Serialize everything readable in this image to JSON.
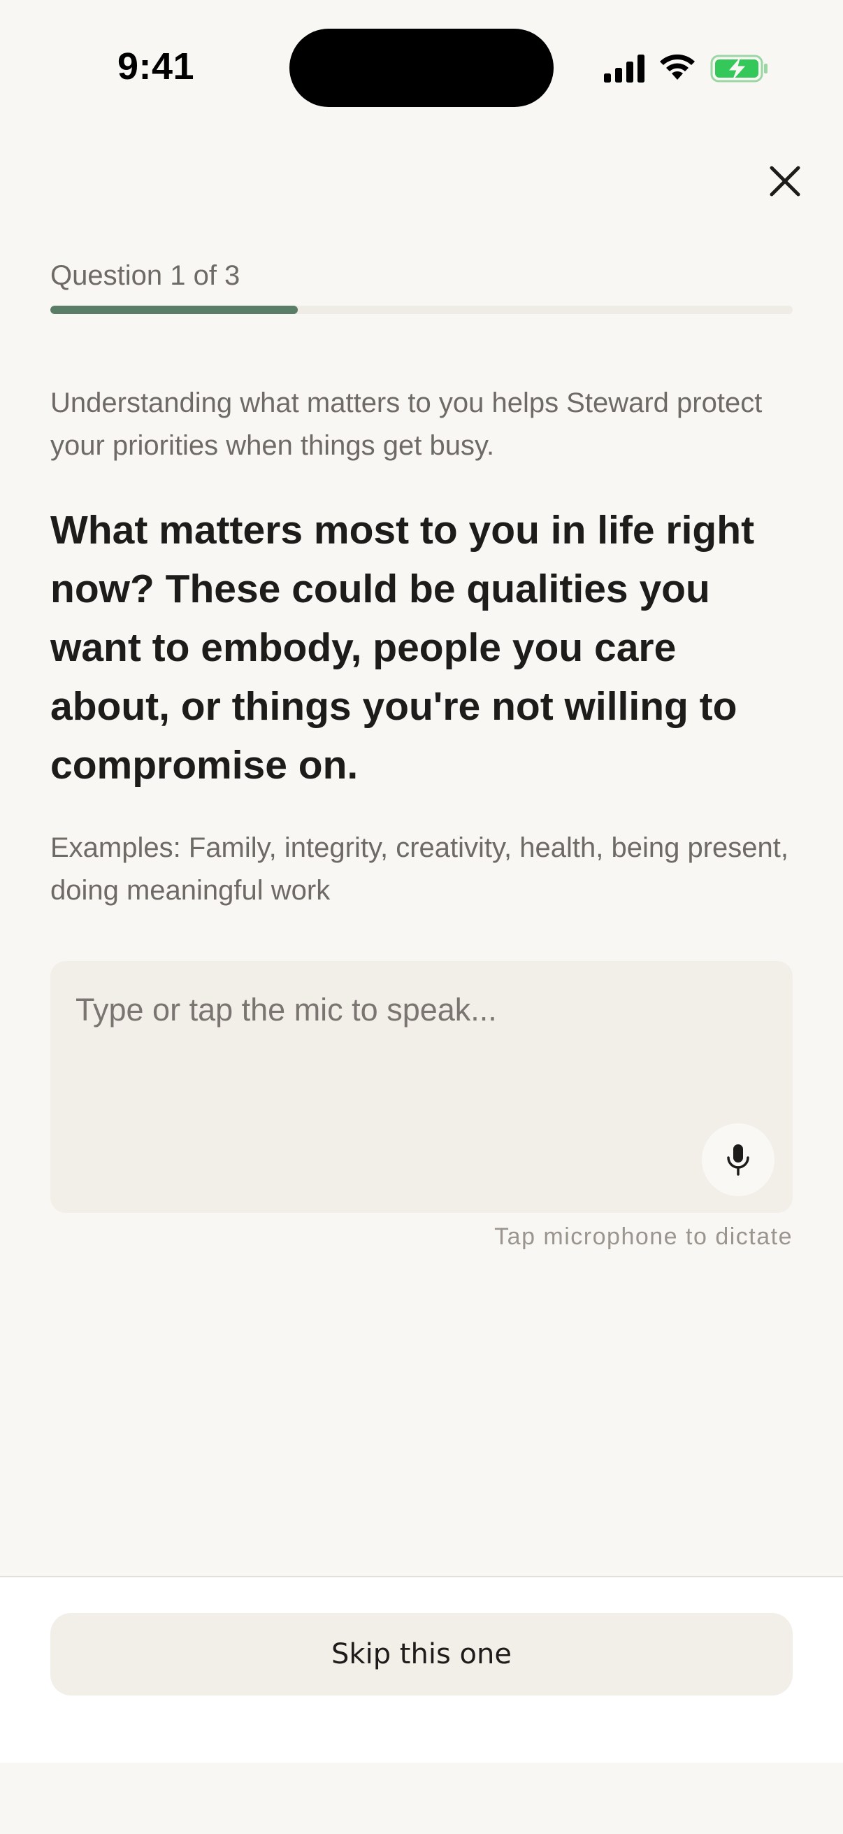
{
  "status_bar": {
    "time": "9:41",
    "icons": [
      "signal-icon",
      "wifi-icon",
      "battery-charging-icon"
    ],
    "battery_color": "#34C759"
  },
  "header": {
    "close_icon": "close-icon"
  },
  "progress": {
    "label": "Question 1 of 3",
    "current": 1,
    "total": 3,
    "fraction": 0.333,
    "fill_color": "#5A7D67"
  },
  "content": {
    "intro": "Understanding what matters to you helps Steward protect your priorities when things get busy.",
    "question": "What matters most to you in life right now? These could be qualities you want to embody, people you care about, or things you're not willing to compromise on.",
    "examples": "Examples: Family, integrity, creativity, health, being present, doing meaningful work"
  },
  "answer": {
    "value": "",
    "placeholder": "Type or tap the mic to speak...",
    "mic_icon": "microphone-icon",
    "mic_hint": "Tap microphone to dictate"
  },
  "footer": {
    "skip_label": "Skip this one"
  }
}
